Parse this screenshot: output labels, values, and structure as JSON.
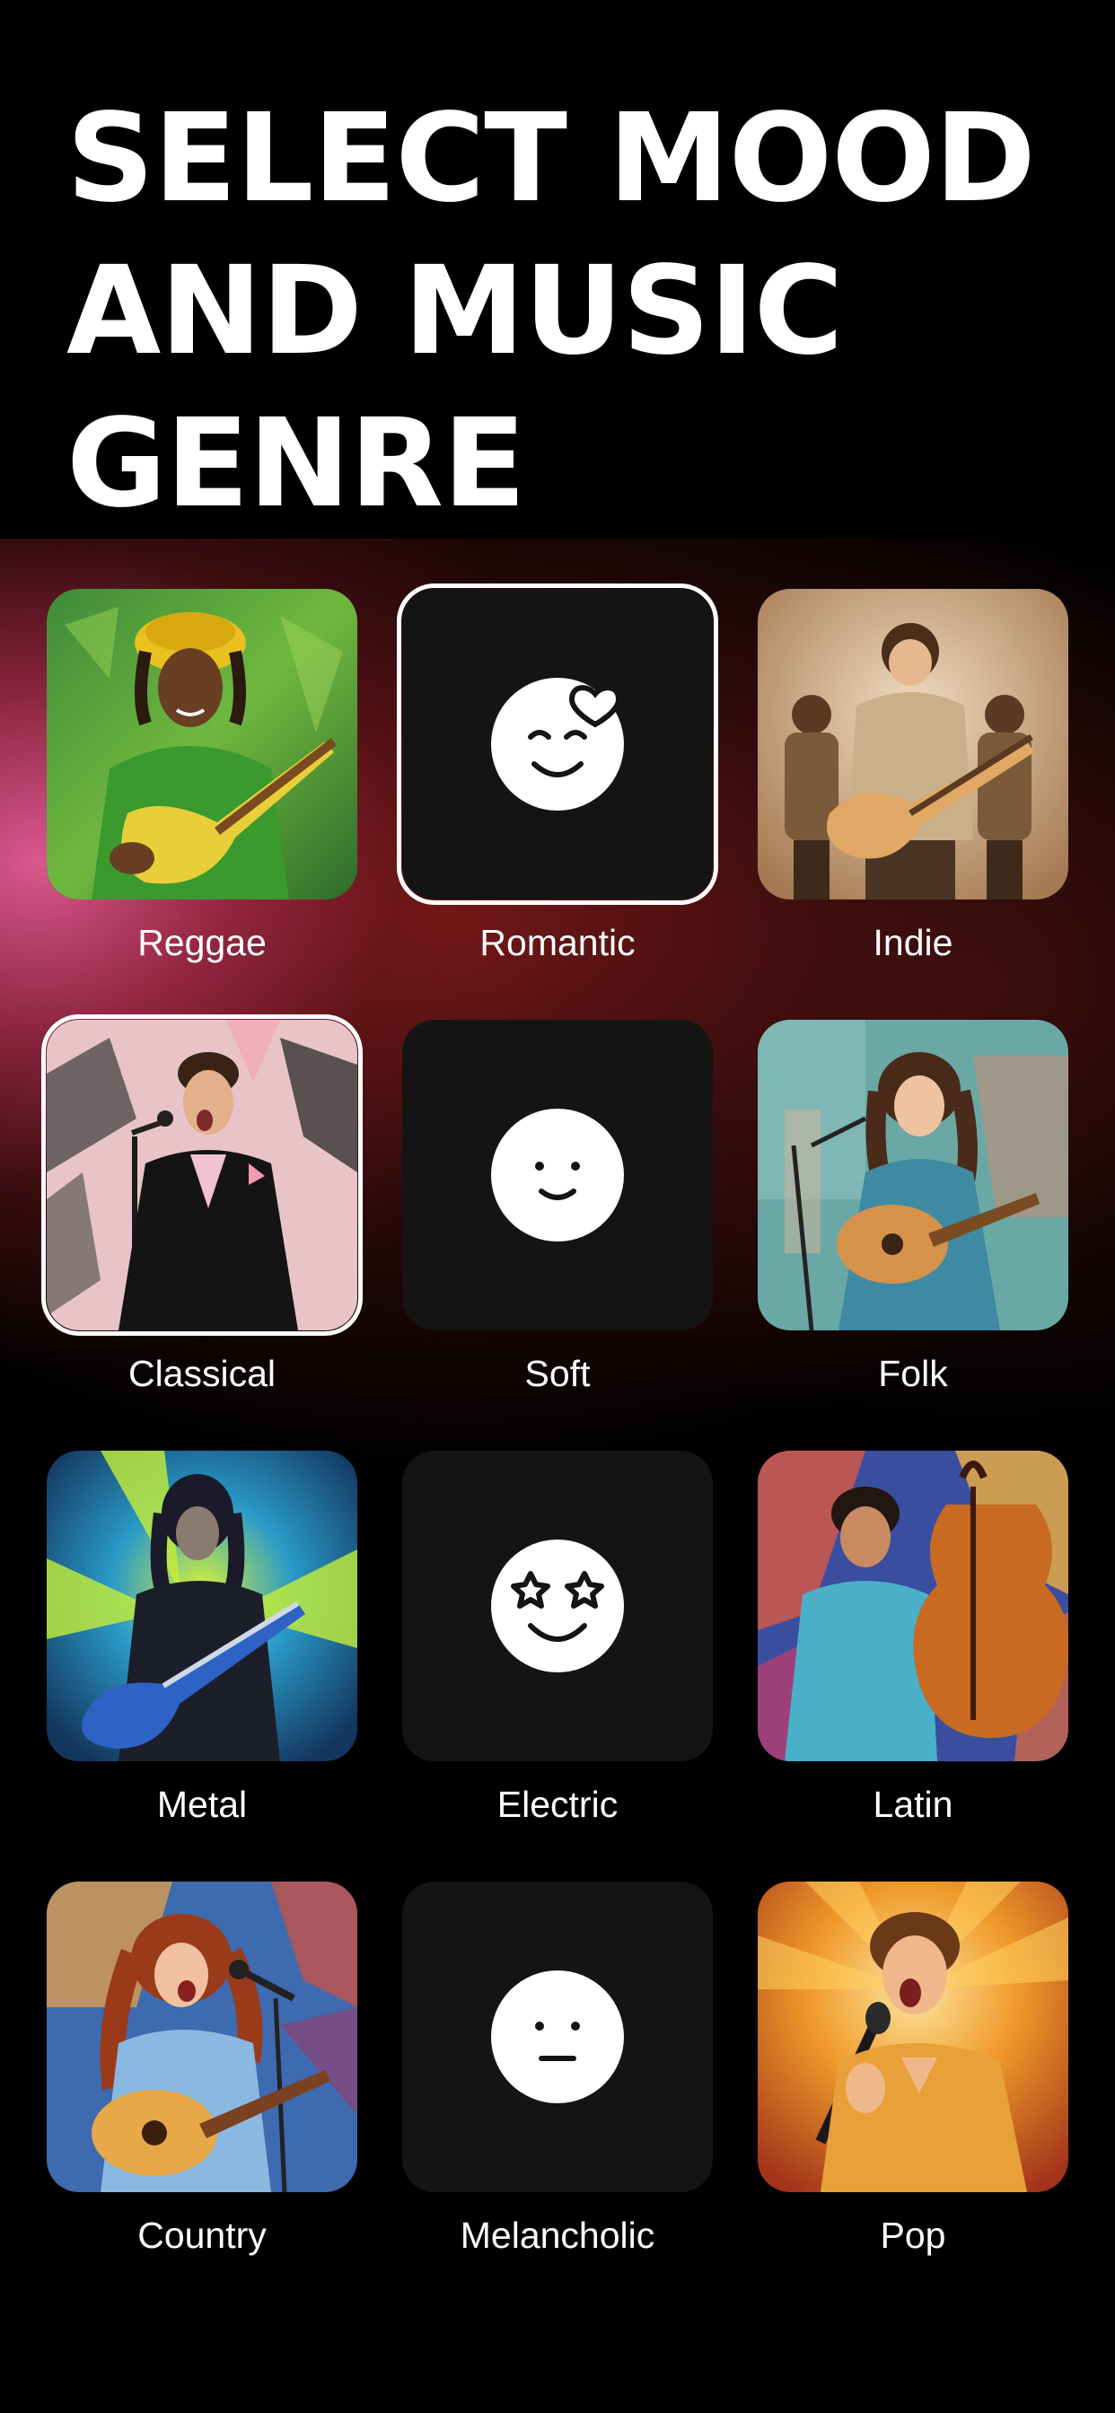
{
  "header": {
    "title": "SELECT MOOD AND MUSIC GENRE"
  },
  "options": {
    "reggae": {
      "label": "Reggae",
      "kind": "genre-art",
      "selected": false
    },
    "romantic": {
      "label": "Romantic",
      "kind": "mood",
      "icon": "smile-heart-icon",
      "selected": true
    },
    "indie": {
      "label": "Indie",
      "kind": "genre-art",
      "selected": false
    },
    "classical": {
      "label": "Classical",
      "kind": "genre-art",
      "selected": true
    },
    "soft": {
      "label": "Soft",
      "kind": "mood",
      "icon": "smile-icon",
      "selected": false
    },
    "folk": {
      "label": "Folk",
      "kind": "genre-art",
      "selected": false
    },
    "metal": {
      "label": "Metal",
      "kind": "genre-art",
      "selected": false
    },
    "electric": {
      "label": "Electric",
      "kind": "mood",
      "icon": "star-eyes-icon",
      "selected": false
    },
    "latin": {
      "label": "Latin",
      "kind": "genre-art",
      "selected": false
    },
    "country": {
      "label": "Country",
      "kind": "genre-art",
      "selected": false
    },
    "melancholic": {
      "label": "Melancholic",
      "kind": "mood",
      "icon": "neutral-face-icon",
      "selected": false
    },
    "pop": {
      "label": "Pop",
      "kind": "genre-art",
      "selected": false
    }
  },
  "colors": {
    "background": "#000000",
    "tile_dark": "#141414",
    "glow_pink": "#e45c96",
    "glow_red": "#962020",
    "text": "#ffffff"
  }
}
